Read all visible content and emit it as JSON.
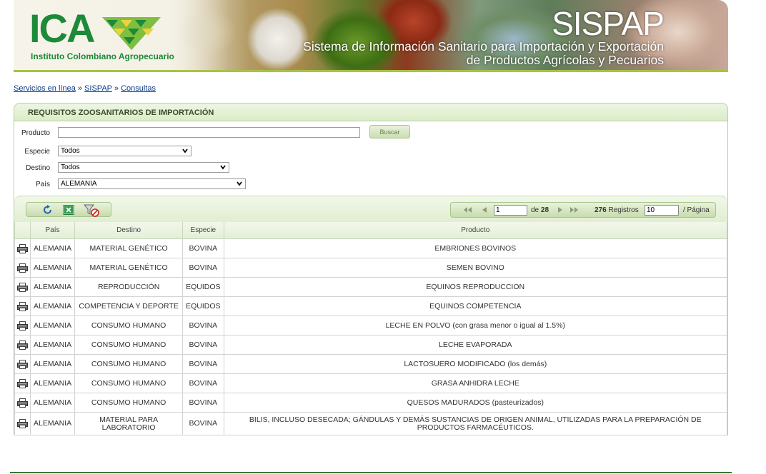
{
  "header": {
    "logo_text": "ICA",
    "logo_subtitle": "Instituto Colombiano Agropecuario",
    "system_name": "SISPAP",
    "system_subtitle": "Sistema de Información Sanitario para Importación y Exportación de Productos Agrícolas y Pecuarios"
  },
  "breadcrumb": {
    "items": [
      "Servicios en línea",
      "SISPAP",
      "Consultas"
    ],
    "separator": "»"
  },
  "panel": {
    "title": "REQUISITOS ZOOSANITARIOS DE IMPORTACIÓN"
  },
  "filters": {
    "producto_label": "Producto",
    "producto_value": "",
    "buscar_label": "Buscar",
    "especie_label": "Especie",
    "especie_value": "Todos",
    "destino_label": "Destino",
    "destino_value": "Todos",
    "pais_label": "País",
    "pais_value": "ALEMANIA"
  },
  "toolbar": {
    "icons": [
      "refresh-icon",
      "excel-export-icon",
      "clear-filter-icon"
    ]
  },
  "pager": {
    "current_page": "1",
    "of_label": "de",
    "total_pages": "28",
    "total_records": "276",
    "records_label": "Registros",
    "page_size": "10",
    "per_page_label": "/ Página"
  },
  "table": {
    "columns": [
      "País",
      "Destino",
      "Especie",
      "Producto"
    ],
    "rows": [
      {
        "pais": "ALEMANIA",
        "destino": "MATERIAL GENÉTICO",
        "especie": "BOVINA",
        "producto": "EMBRIONES BOVINOS"
      },
      {
        "pais": "ALEMANIA",
        "destino": "MATERIAL GENÉTICO",
        "especie": "BOVINA",
        "producto": "SEMEN BOVINO"
      },
      {
        "pais": "ALEMANIA",
        "destino": "REPRODUCCIÓN",
        "especie": "EQUIDOS",
        "producto": "EQUINOS REPRODUCCION"
      },
      {
        "pais": "ALEMANIA",
        "destino": "COMPETENCIA Y DEPORTE",
        "especie": "EQUIDOS",
        "producto": "EQUINOS COMPETENCIA"
      },
      {
        "pais": "ALEMANIA",
        "destino": "CONSUMO HUMANO",
        "especie": "BOVINA",
        "producto": "LECHE EN POLVO (con grasa menor o igual al 1.5%)"
      },
      {
        "pais": "ALEMANIA",
        "destino": "CONSUMO HUMANO",
        "especie": "BOVINA",
        "producto": "LECHE EVAPORADA"
      },
      {
        "pais": "ALEMANIA",
        "destino": "CONSUMO HUMANO",
        "especie": "BOVINA",
        "producto": "LACTOSUERO MODIFICADO (los demás)"
      },
      {
        "pais": "ALEMANIA",
        "destino": "CONSUMO HUMANO",
        "especie": "BOVINA",
        "producto": "GRASA ANHIDRA LECHE"
      },
      {
        "pais": "ALEMANIA",
        "destino": "CONSUMO HUMANO",
        "especie": "BOVINA",
        "producto": "QUESOS MADURADOS (pasteurizados)"
      },
      {
        "pais": "ALEMANIA",
        "destino": "MATERIAL PARA LABORATORIO",
        "especie": "BOVINA",
        "producto": "BILIS, INCLUSO DESECADA; GÁNDULAS Y DEMÁS SUSTANCIAS DE ORIGEN ANIMAL, UTILIZADAS PARA LA PREPARACIÓN DE PRODUCTOS FARMACÉUTICOS."
      }
    ]
  },
  "colors": {
    "brand_green": "#1c8a38",
    "panel_border": "#b7cfa5",
    "link_blue": "#0b3d8c"
  }
}
